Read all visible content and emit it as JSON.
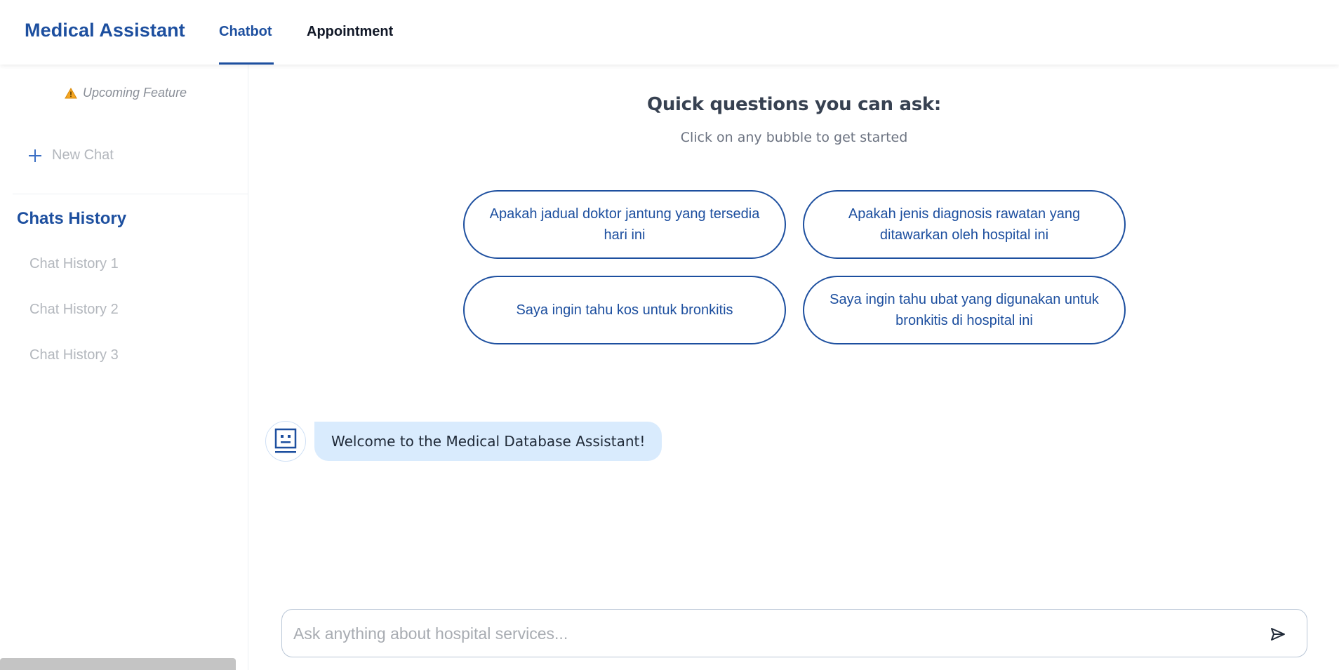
{
  "header": {
    "brand": "Medical Assistant",
    "tabs": [
      {
        "label": "Chatbot",
        "active": true
      },
      {
        "label": "Appointment",
        "active": false
      }
    ]
  },
  "sidebar": {
    "upcoming_label": "Upcoming Feature",
    "new_chat_label": "New Chat",
    "history_title": "Chats History",
    "history_items": [
      {
        "label": "Chat History 1"
      },
      {
        "label": "Chat History 2"
      },
      {
        "label": "Chat History 3"
      }
    ]
  },
  "main": {
    "quick_title": "Quick questions you can ask:",
    "quick_subtitle": "Click on any bubble to get started",
    "quick_questions": [
      {
        "text": "Apakah jadual doktor jantung yang tersedia hari ini"
      },
      {
        "text": "Apakah jenis diagnosis rawatan yang ditawarkan oleh hospital ini"
      },
      {
        "text": "Saya ingin tahu kos untuk bronkitis"
      },
      {
        "text": "Saya ingin tahu ubat yang digunakan untuk bronkitis di hospital ini"
      }
    ],
    "welcome_message": "Welcome to the Medical Database Assistant!",
    "input_placeholder": "Ask anything about hospital services...",
    "input_value": ""
  },
  "icons": {
    "warning": "warning-icon",
    "plus": "plus-icon",
    "bot": "robot-icon",
    "send": "send-icon"
  },
  "colors": {
    "primary": "#1d4f9f",
    "bubble_bg": "#d9ebfd",
    "muted_text": "#b3b7bd",
    "warning": "#f5a623"
  }
}
